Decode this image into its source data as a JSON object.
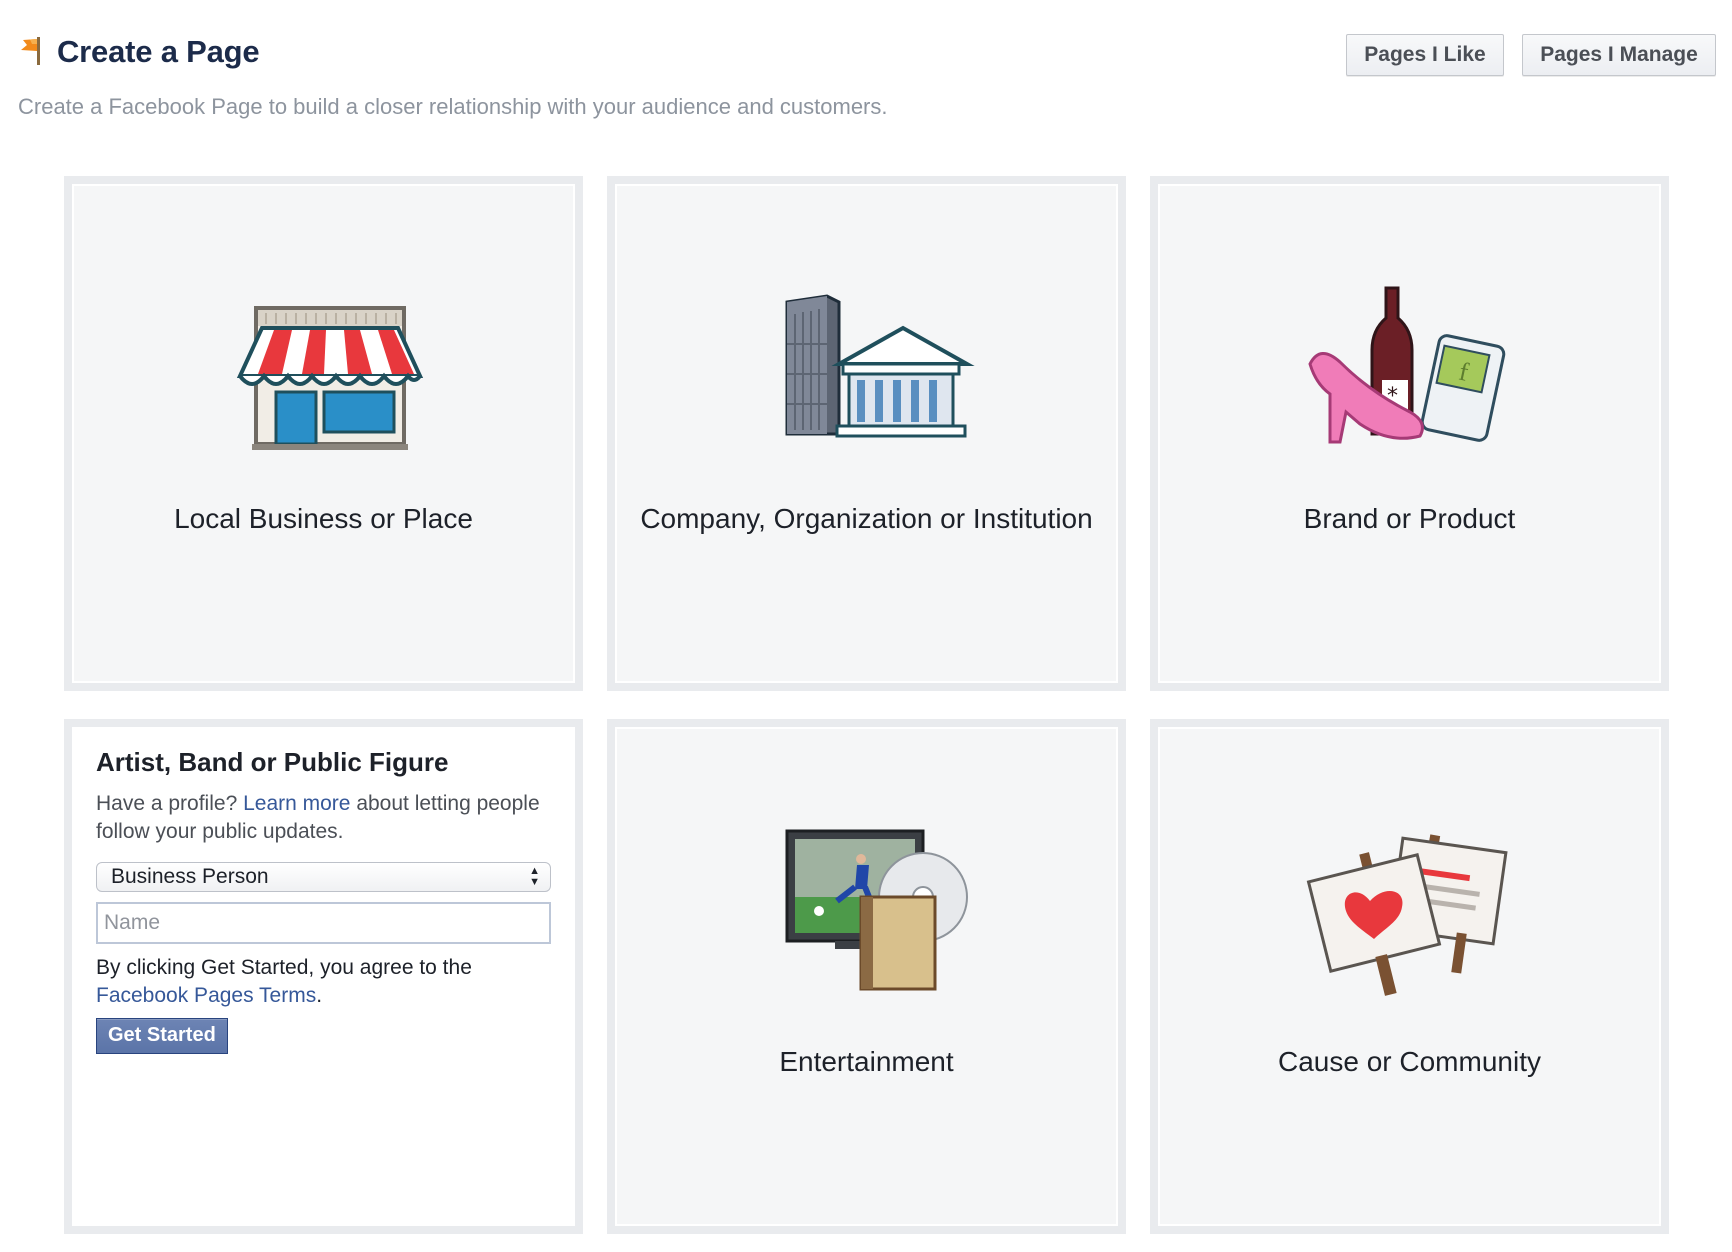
{
  "header": {
    "title": "Create a Page",
    "subtitle": "Create a Facebook Page to build a closer relationship with your audience and customers.",
    "buttons": {
      "pages_i_like": "Pages I Like",
      "pages_i_manage": "Pages I Manage"
    }
  },
  "categories": [
    {
      "label": "Local Business or Place",
      "icon": "storefront-icon"
    },
    {
      "label": "Company, Organization or Institution",
      "icon": "buildings-icon"
    },
    {
      "label": "Brand or Product",
      "icon": "products-icon"
    },
    {
      "label": "Entertainment",
      "icon": "media-icon"
    },
    {
      "label": "Cause or Community",
      "icon": "signs-icon"
    }
  ],
  "artist_card": {
    "title": "Artist, Band or Public Figure",
    "desc_prefix": "Have a profile? ",
    "learn_more": "Learn more",
    "desc_suffix": " about letting people follow your public updates.",
    "category_selected": "Business Person",
    "name_placeholder": "Name",
    "terms_prefix": "By clicking Get Started, you agree to the ",
    "terms_link": "Facebook Pages Terms",
    "terms_suffix": ".",
    "button": "Get Started"
  },
  "colors": {
    "title": "#1c2b4a",
    "link": "#365899",
    "button": "#5b74a8",
    "card_border": "#e9ebee",
    "card_bg": "#f5f6f7"
  }
}
